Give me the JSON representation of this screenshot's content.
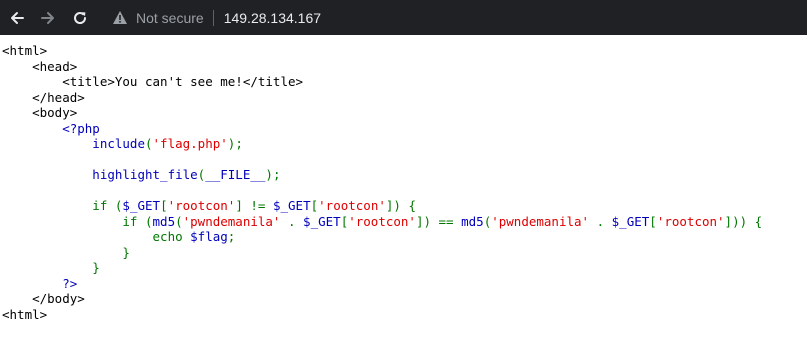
{
  "browser": {
    "security_label": "Not secure",
    "url": "149.28.134.167",
    "icons": [
      "back-arrow-icon",
      "forward-arrow-icon",
      "reload-icon",
      "warning-triangle-icon"
    ]
  },
  "colors": {
    "html": "#000000",
    "default": "#0000BB",
    "keyword": "#007700",
    "string": "#DD0000"
  },
  "source_lines": [
    [
      [
        "html",
        "<html>"
      ]
    ],
    [
      [
        "html",
        "    <head>"
      ]
    ],
    [
      [
        "html",
        "        <title>You can't see me!</title>"
      ]
    ],
    [
      [
        "html",
        "    </head>"
      ]
    ],
    [
      [
        "html",
        "    <body>"
      ]
    ],
    [
      [
        "def",
        "        <?php"
      ]
    ],
    [
      [
        "def",
        "            include"
      ],
      [
        "kw",
        "("
      ],
      [
        "str",
        "'flag.php'"
      ],
      [
        "kw",
        ");"
      ]
    ],
    [
      [
        "def",
        ""
      ]
    ],
    [
      [
        "def",
        "            highlight_file"
      ],
      [
        "kw",
        "("
      ],
      [
        "def",
        "__FILE__"
      ],
      [
        "kw",
        ");"
      ]
    ],
    [
      [
        "def",
        ""
      ]
    ],
    [
      [
        "kw",
        "            if ("
      ],
      [
        "def",
        "$_GET"
      ],
      [
        "kw",
        "["
      ],
      [
        "str",
        "'rootcon'"
      ],
      [
        "kw",
        "] != "
      ],
      [
        "def",
        "$_GET"
      ],
      [
        "kw",
        "["
      ],
      [
        "str",
        "'rootcon'"
      ],
      [
        "kw",
        "]) {"
      ]
    ],
    [
      [
        "kw",
        "                if ("
      ],
      [
        "def",
        "md5"
      ],
      [
        "kw",
        "("
      ],
      [
        "str",
        "'pwndemanila'"
      ],
      [
        "kw",
        " . "
      ],
      [
        "def",
        "$_GET"
      ],
      [
        "kw",
        "["
      ],
      [
        "str",
        "'rootcon'"
      ],
      [
        "kw",
        "]) == "
      ],
      [
        "def",
        "md5"
      ],
      [
        "kw",
        "("
      ],
      [
        "str",
        "'pwndemanila'"
      ],
      [
        "kw",
        " . "
      ],
      [
        "def",
        "$_GET"
      ],
      [
        "kw",
        "["
      ],
      [
        "str",
        "'rootcon'"
      ],
      [
        "kw",
        "])) {"
      ]
    ],
    [
      [
        "kw",
        "                    echo "
      ],
      [
        "def",
        "$flag"
      ],
      [
        "kw",
        ";"
      ]
    ],
    [
      [
        "kw",
        "                }"
      ]
    ],
    [
      [
        "kw",
        "            }"
      ]
    ],
    [
      [
        "def",
        "        ?>"
      ]
    ],
    [
      [
        "html",
        "    </body>"
      ]
    ],
    [
      [
        "html",
        "<html>"
      ]
    ]
  ]
}
